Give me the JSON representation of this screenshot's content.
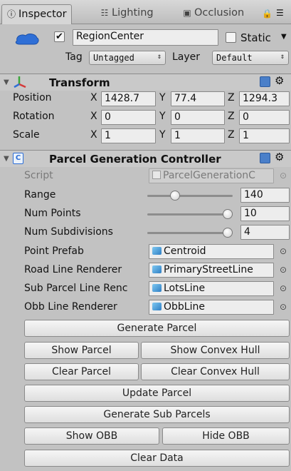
{
  "tabs": [
    {
      "label": "Inspector",
      "icon": "info-icon"
    },
    {
      "label": "Lighting",
      "icon": "lighting-icon"
    },
    {
      "label": "Occlusion",
      "icon": "occlusion-icon"
    }
  ],
  "header": {
    "active_checked": true,
    "name": "RegionCenter",
    "static_label": "Static",
    "tag_label": "Tag",
    "tag_value": "Untagged",
    "layer_label": "Layer",
    "layer_value": "Default"
  },
  "transform": {
    "title": "Transform",
    "rows": [
      {
        "label": "Position",
        "x": "1428.7",
        "y": "77.4",
        "z": "1294.3"
      },
      {
        "label": "Rotation",
        "x": "0",
        "y": "0",
        "z": "0"
      },
      {
        "label": "Scale",
        "x": "1",
        "y": "1",
        "z": "1"
      }
    ],
    "axis_x": "X",
    "axis_y": "Y",
    "axis_z": "Z"
  },
  "component": {
    "title": "Parcel Generation Controller",
    "script_label": "Script",
    "script_value": "ParcelGenerationC",
    "sliders": [
      {
        "label": "Range",
        "value": "140",
        "fraction": 0.3
      },
      {
        "label": "Num Points",
        "value": "10",
        "fraction": 1.0
      },
      {
        "label": "Num Subdivisions",
        "value": "4",
        "fraction": 1.0
      }
    ],
    "refs": [
      {
        "label": "Point Prefab",
        "value": "Centroid"
      },
      {
        "label": "Road Line Renderer",
        "value": "PrimaryStreetLine"
      },
      {
        "label": "Sub Parcel Line Renc",
        "value": "LotsLine"
      },
      {
        "label": "Obb Line Renderer",
        "value": "ObbLine"
      }
    ],
    "buttons": {
      "generate_parcel": "Generate Parcel",
      "show_parcel": "Show Parcel",
      "show_convex_hull": "Show Convex Hull",
      "clear_parcel": "Clear Parcel",
      "clear_convex_hull": "Clear Convex Hull",
      "update_parcel": "Update Parcel",
      "generate_sub_parcels": "Generate Sub Parcels",
      "show_obb": "Show OBB",
      "hide_obb": "Hide OBB",
      "clear_data": "Clear Data"
    }
  },
  "colors": {
    "bg": "#c2c2c2",
    "cloud_icon": "#2f6fd6"
  }
}
